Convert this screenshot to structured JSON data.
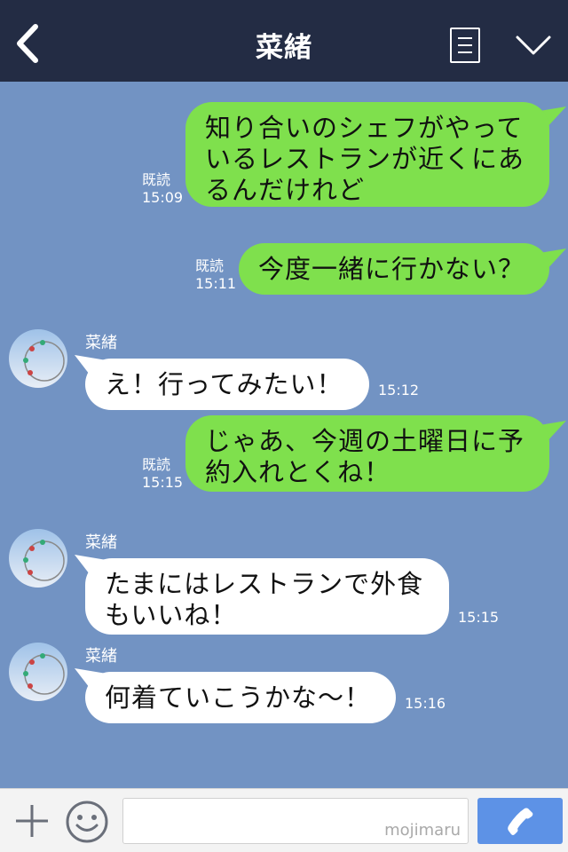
{
  "header": {
    "title": "菜緒"
  },
  "messages": [
    {
      "side": "me",
      "lines": [
        "知り合いのシェフがやって",
        "いるレストランが近くにあ",
        "るんだけれど"
      ],
      "read": "既読",
      "time": "15:09"
    },
    {
      "side": "me",
      "lines": [
        "今度一緒に行かない？"
      ],
      "read": "既読",
      "time": "15:11"
    },
    {
      "side": "them",
      "sender": "菜緒",
      "lines": [
        "え！行ってみたい！"
      ],
      "time": "15:12"
    },
    {
      "side": "me",
      "lines": [
        "じゃあ、今週の土曜日に予",
        "約入れとくね！"
      ],
      "read": "既読",
      "time": "15:15"
    },
    {
      "side": "them",
      "sender": "菜緒",
      "lines": [
        "たまにはレストランで外食",
        "もいいね！"
      ],
      "time": "15:15"
    },
    {
      "side": "them",
      "sender": "菜緒",
      "lines": [
        "何着ていこうかな〜！"
      ],
      "time": "15:16"
    }
  ],
  "footer": {
    "watermark": "mojimaru"
  },
  "colors": {
    "header": "#232c44",
    "chat_bg": "#7293c3",
    "my_bubble": "#7fe04d",
    "their_bubble": "#ffffff",
    "call_button": "#5d92e6"
  },
  "icons": {
    "back": "chevron-left-icon",
    "menu": "menu-list-icon",
    "more": "chevron-down-icon",
    "add": "plus-icon",
    "emoji": "smiley-icon",
    "call": "phone-icon"
  }
}
